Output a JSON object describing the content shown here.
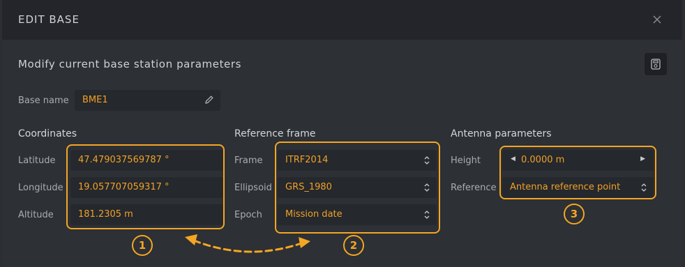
{
  "dialog": {
    "title": "EDIT BASE",
    "close_icon": "close-icon",
    "subtitle": "Modify current base station parameters",
    "save_icon": "save-icon"
  },
  "base": {
    "label": "Base name",
    "value": "BME1"
  },
  "coordinates": {
    "title": "Coordinates",
    "latitude": {
      "label": "Latitude",
      "value": "47.479037569787 °"
    },
    "longitude": {
      "label": "Longitude",
      "value": "19.057707059317 °"
    },
    "altitude": {
      "label": "Altitude",
      "value": "181.2305 m"
    }
  },
  "reference_frame": {
    "title": "Reference frame",
    "frame": {
      "label": "Frame",
      "value": "ITRF2014"
    },
    "ellipsoid": {
      "label": "Ellipsoid",
      "value": "GRS_1980"
    },
    "epoch": {
      "label": "Epoch",
      "value": "Mission date"
    }
  },
  "antenna": {
    "title": "Antenna parameters",
    "height": {
      "label": "Height",
      "value": "0.0000 m"
    },
    "reference": {
      "label": "Reference",
      "value": "Antenna reference point"
    }
  },
  "annotations": {
    "one": "1",
    "two": "2",
    "three": "3",
    "color": "#f5a623"
  }
}
